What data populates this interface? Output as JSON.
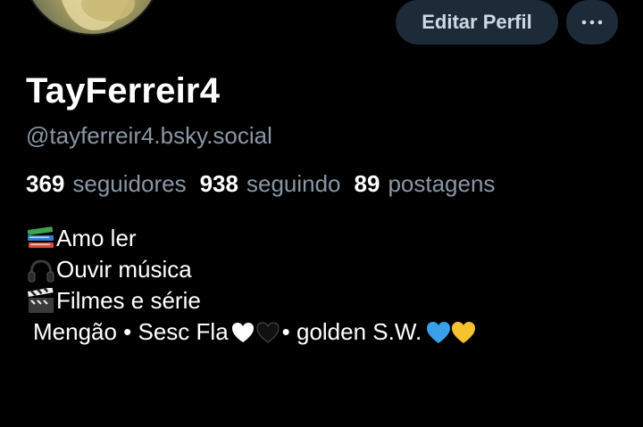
{
  "profile": {
    "display_name": "TayFerreir4",
    "handle": "@tayferreir4.bsky.social",
    "edit_label": "Editar Perfil",
    "more_label": "···"
  },
  "stats": [
    {
      "count": "369",
      "label": "seguidores"
    },
    {
      "count": "938",
      "label": "seguindo"
    },
    {
      "count": "89",
      "label": "postagens"
    }
  ],
  "bio": {
    "line1": "Amo ler",
    "line2": "Ouvir música",
    "line3": "Filmes e série",
    "line4_part1": "Mengão • Sesc Fla",
    "line4_part2": "• golden S.W.",
    "emoji1": "books-icon",
    "emoji2": "headphones-icon",
    "emoji3": "clapper-board-icon"
  },
  "colors": {
    "background": "#000000",
    "button_bg": "#1d2a38",
    "muted_text": "#8a96a5"
  }
}
